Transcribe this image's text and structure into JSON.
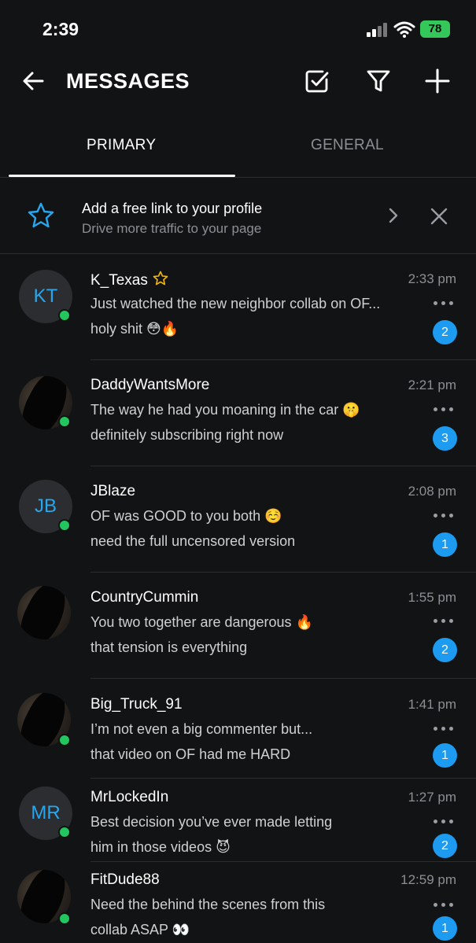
{
  "status_bar": {
    "time": "2:39",
    "battery": "78"
  },
  "header": {
    "title": "MESSAGES"
  },
  "tabs": [
    {
      "label": "PRIMARY"
    },
    {
      "label": "GENERAL"
    }
  ],
  "promo": {
    "title": "Add a free link to your profile",
    "subtitle": "Drive more traffic to your page"
  },
  "colors": {
    "accent": "#1d9bf0",
    "online": "#22c55e",
    "star": "#f5b800",
    "background": "#121314"
  },
  "conversations": [
    {
      "initials": "KT",
      "name": "K_Texas",
      "time": "2:33 pm",
      "line1": "Just watched the new neighbor collab on OF...",
      "line2": "holy shit 😳🔥",
      "unread": "2"
    },
    {
      "initials": "",
      "name": "DaddyWantsMore",
      "time": "2:21 pm",
      "line1": "The way he had you moaning in the car 🤫",
      "line2": "definitely subscribing right now",
      "unread": "3"
    },
    {
      "initials": "JB",
      "name": "JBlaze",
      "time": "2:08 pm",
      "line1": "OF was GOOD to you both ☺️",
      "line2": "need the full uncensored version",
      "unread": "1"
    },
    {
      "initials": "",
      "name": "CountryCummin",
      "time": "1:55 pm",
      "line1": "You two together are dangerous 🔥",
      "line2": "that tension is everything",
      "unread": "2"
    },
    {
      "initials": "",
      "name": "Big_Truck_91",
      "time": "1:41 pm",
      "line1": "I’m not even a big commenter but...",
      "line2": "that video on OF had me HARD",
      "unread": "1"
    },
    {
      "initials": "MR",
      "name": "MrLockedIn",
      "time": "1:27 pm",
      "line1": "Best decision you’ve ever made letting",
      "line2": "him in those videos 😈",
      "unread": "2"
    },
    {
      "initials": "",
      "name": "FitDude88",
      "time": "12:59 pm",
      "line1": "Need the behind the scenes from this",
      "line2": "collab ASAP 👀",
      "unread": "1"
    }
  ]
}
